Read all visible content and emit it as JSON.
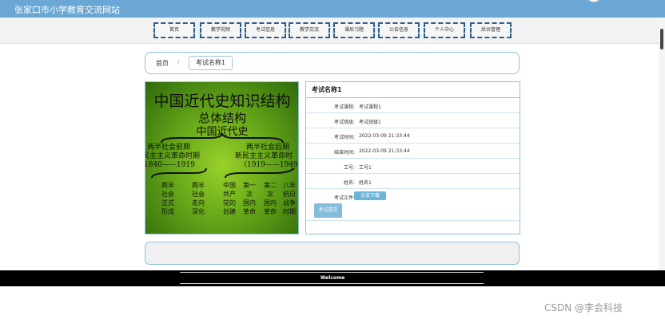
{
  "site": {
    "title": "张家口市小学教育交流网站"
  },
  "nav": {
    "items": [
      {
        "label": "首页"
      },
      {
        "label": "教学视频"
      },
      {
        "label": "考试信息"
      },
      {
        "label": "教学交流"
      },
      {
        "label": "课后习题"
      },
      {
        "label": "公告信息"
      },
      {
        "label": "个人中心"
      },
      {
        "label": "后台管理"
      }
    ]
  },
  "breadcrumb": {
    "home": "首页",
    "separator": "/",
    "current": "考试名称1"
  },
  "poster": {
    "title": "中国近代史知识结构",
    "subtitle": "总体结构",
    "root": "中国近代史",
    "left_branch": [
      "两半社会前期",
      "民主主义革命时期",
      "1840——1919"
    ],
    "right_branch": [
      "两半社会后期",
      "新民主主义革命时",
      "（1919——1949）"
    ],
    "columns": [
      [
        "两半",
        "社会",
        "正式",
        "形成"
      ],
      [
        "两半",
        "社会",
        "走向",
        "深化"
      ],
      [
        "中国",
        "共产",
        "党的",
        "创建"
      ],
      [
        "第一",
        "次",
        "国内",
        "革命"
      ],
      [
        "第二",
        "次",
        "国内",
        "革命"
      ],
      [
        "八年",
        "抗日",
        "战争",
        "时期"
      ]
    ]
  },
  "detail": {
    "title": "考试名称1",
    "fields": [
      {
        "label": "考试课程:",
        "value": "考试课程1"
      },
      {
        "label": "考试班级:",
        "value": "考试班级1"
      },
      {
        "label": "考试时间:",
        "value": "2022-03-09 21:33:44"
      },
      {
        "label": "结束时间:",
        "value": "2022-03-09 21:33:44"
      },
      {
        "label": "工号:",
        "value": "工号1"
      },
      {
        "label": "姓名:",
        "value": "姓名1"
      }
    ],
    "file_label": "考试文件:",
    "download_label": "点击下载",
    "submit_label": "考试提交"
  },
  "footer": {
    "text": "Welcome"
  },
  "watermark": "CSDN @李会科技",
  "colors": {
    "topbar": "#6aa7d4",
    "accent": "#6cb4d8",
    "border": "#8fc2d9",
    "nav_border": "#2f5d8a"
  }
}
